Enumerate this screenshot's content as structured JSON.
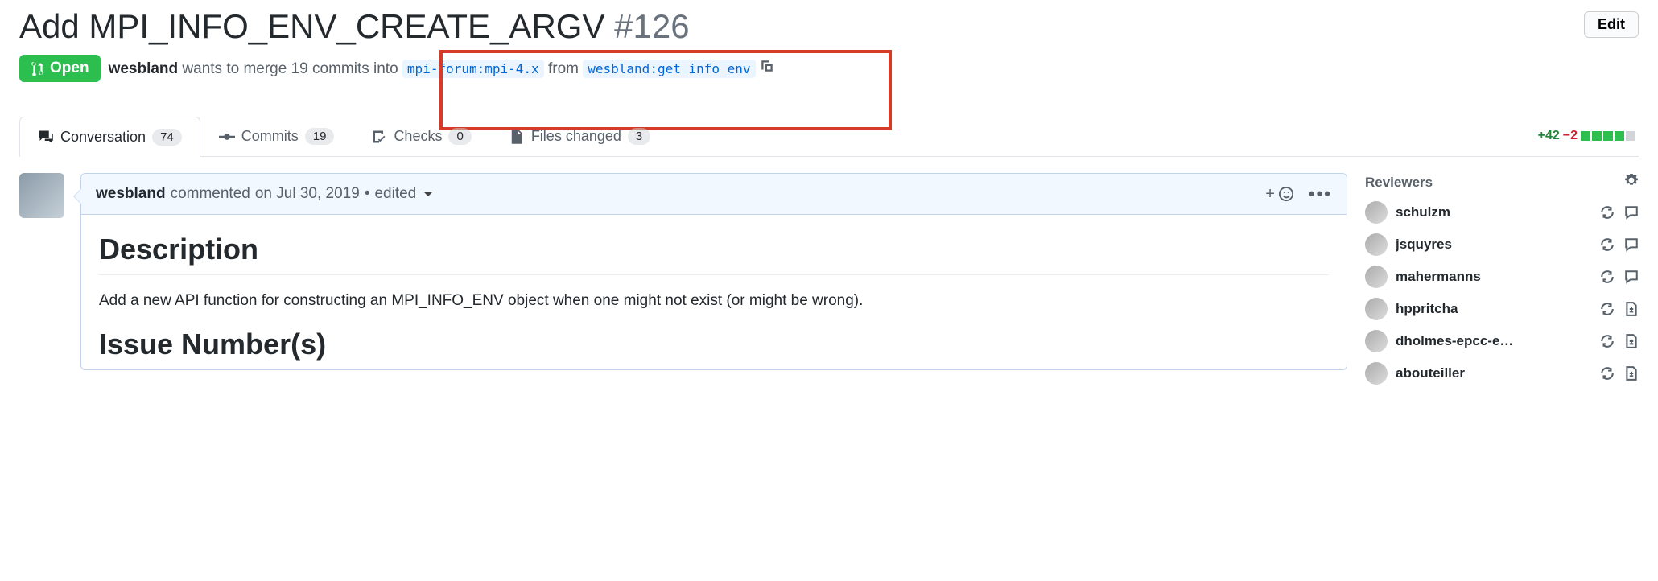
{
  "pr": {
    "title": "Add MPI_INFO_ENV_CREATE_ARGV",
    "number": "#126",
    "state": "Open",
    "edit_label": "Edit",
    "author": "wesbland",
    "merge_prefix": " wants to merge 19 commits into ",
    "base_branch": "mpi-forum:mpi-4.x",
    "from_word": " from ",
    "head_branch": "wesbland:get_info_env"
  },
  "tabs": {
    "conversation": {
      "label": "Conversation",
      "count": "74"
    },
    "commits": {
      "label": "Commits",
      "count": "19"
    },
    "checks": {
      "label": "Checks",
      "count": "0"
    },
    "files": {
      "label": "Files changed",
      "count": "3"
    }
  },
  "diff": {
    "add": "+42",
    "del": "−2"
  },
  "comment": {
    "author": "wesbland",
    "verb": " commented ",
    "date": "on Jul 30, 2019",
    "edited": "edited",
    "h1": "Description",
    "p1": "Add a new API function for constructing an MPI_INFO_ENV object when one might not exist (or might be wrong).",
    "h2": "Issue Number(s)"
  },
  "sidebar": {
    "reviewers_label": "Reviewers",
    "reviewers": [
      {
        "name": "schulzm",
        "action": "comment"
      },
      {
        "name": "jsquyres",
        "action": "comment"
      },
      {
        "name": "mahermanns",
        "action": "comment"
      },
      {
        "name": "hppritcha",
        "action": "filediff"
      },
      {
        "name": "dholmes-epcc-e…",
        "action": "filediff"
      },
      {
        "name": "abouteiller",
        "action": "filediff"
      }
    ]
  }
}
